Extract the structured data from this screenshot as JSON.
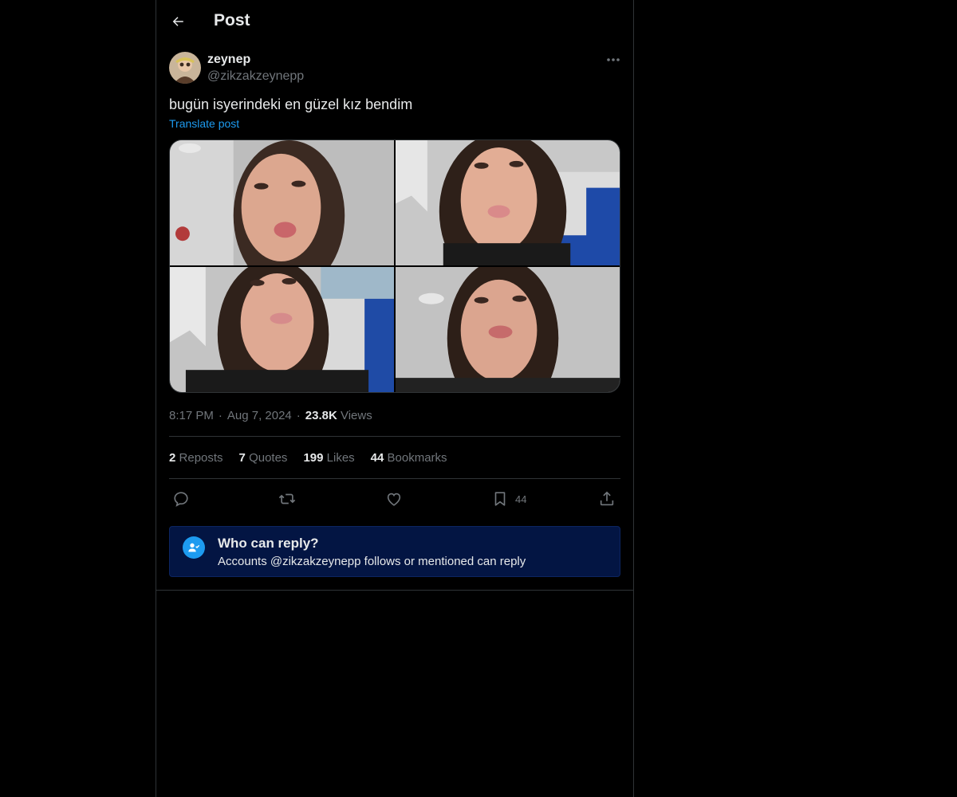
{
  "header": {
    "back_icon": "arrow-left-icon",
    "title": "Post"
  },
  "post": {
    "author": {
      "display_name": "zeynep",
      "handle": "@zikzakzeynepp",
      "avatar_icon": "avatar"
    },
    "more_icon": "more-dots-icon",
    "text": "bugün isyerindeki en güzel kız bendim",
    "translate_label": "Translate post",
    "media": [
      {
        "label": "photo-1"
      },
      {
        "label": "photo-2"
      },
      {
        "label": "photo-3"
      },
      {
        "label": "photo-4"
      }
    ],
    "meta": {
      "time": "8:17 PM",
      "separator": "·",
      "date": "Aug 7, 2024",
      "views_count": "23.8K",
      "views_label": "Views"
    },
    "stats": [
      {
        "count": "2",
        "label": "Reposts"
      },
      {
        "count": "7",
        "label": "Quotes"
      },
      {
        "count": "199",
        "label": "Likes"
      },
      {
        "count": "44",
        "label": "Bookmarks"
      }
    ],
    "actions": {
      "reply_icon": "reply-icon",
      "repost_icon": "repost-icon",
      "like_icon": "heart-icon",
      "bookmark_icon": "bookmark-icon",
      "bookmark_count": "44",
      "share_icon": "share-icon"
    },
    "who_can_reply": {
      "title": "Who can reply?",
      "description": "Accounts @zikzakzeynepp follows or mentioned can reply",
      "icon": "person-check-icon"
    }
  },
  "colors": {
    "background": "#000000",
    "text_primary": "#e7e9ea",
    "text_secondary": "#71767b",
    "accent": "#1d9bf0",
    "border": "#2f3336",
    "reply_box_bg": "#031543"
  }
}
